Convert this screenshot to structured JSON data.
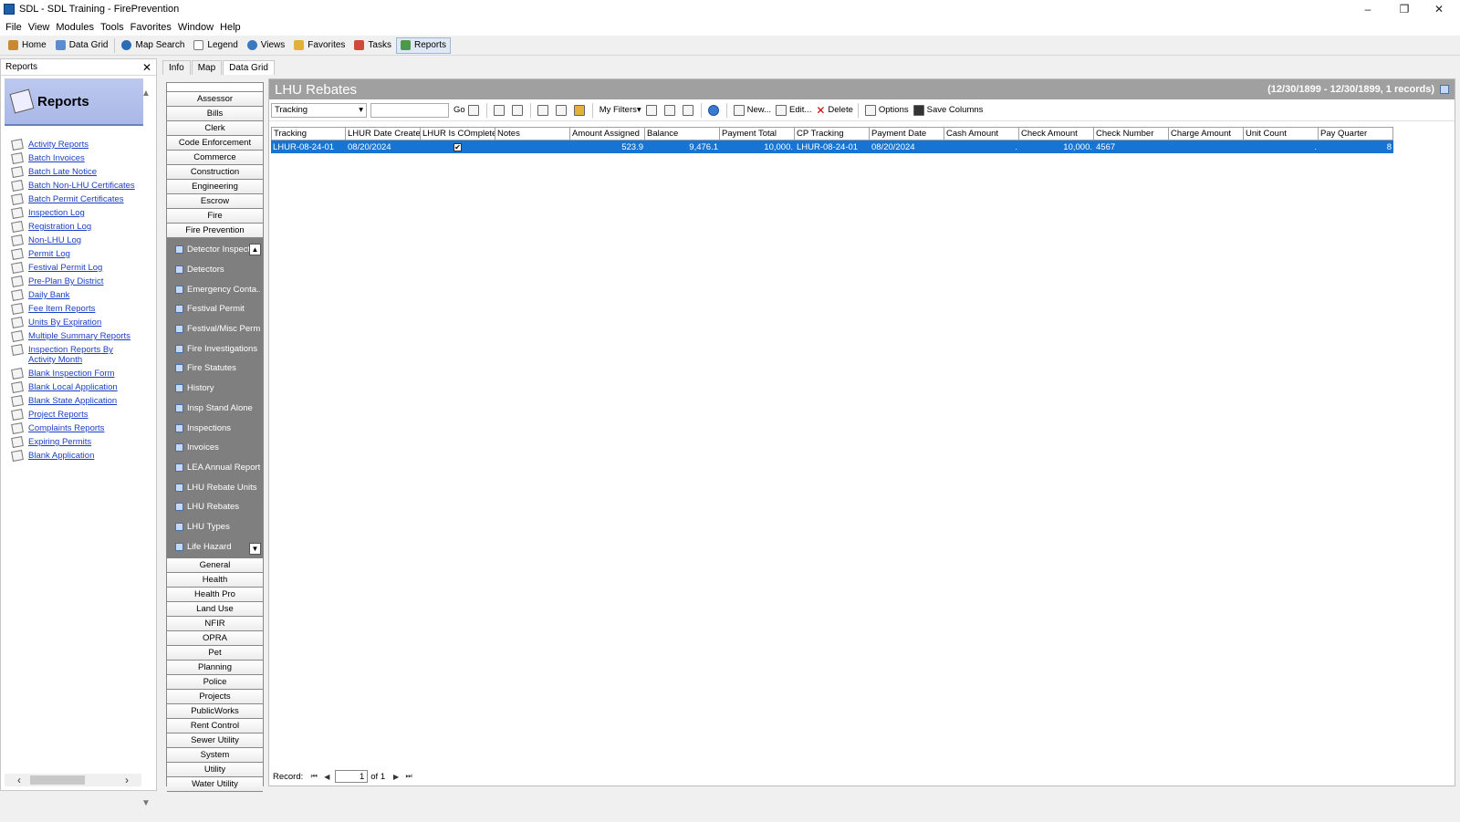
{
  "window": {
    "title": "SDL - SDL Training - FirePrevention"
  },
  "menu": [
    "File",
    "View",
    "Modules",
    "Tools",
    "Favorites",
    "Window",
    "Help"
  ],
  "toolbar": [
    {
      "label": "Home",
      "icon": "home-icon",
      "color": "#c98a2e"
    },
    {
      "label": "Data Grid",
      "icon": "grid-icon",
      "color": "#5b8bd0"
    },
    {
      "label": "Map Search",
      "icon": "globe-icon",
      "color": "#2a6db5"
    },
    {
      "label": "Legend",
      "icon": "legend-icon",
      "color": "#7a7a7a"
    },
    {
      "label": "Views",
      "icon": "views-icon",
      "color": "#3b78c2"
    },
    {
      "label": "Favorites",
      "icon": "folder-icon",
      "color": "#e3b13a"
    },
    {
      "label": "Tasks",
      "icon": "tasks-icon",
      "color": "#d04a3a"
    },
    {
      "label": "Reports",
      "icon": "reports-icon",
      "color": "#4b9a4b"
    }
  ],
  "leftpanel": {
    "header": "Reports",
    "banner": "Reports",
    "items": [
      "Activity Reports",
      "Batch Invoices",
      "Batch Late Notice",
      "Batch Non-LHU Certificates",
      "Batch Permit Certificates",
      "Inspection Log",
      "Registration Log",
      "Non-LHU Log",
      "Permit Log",
      "Festival Permit Log",
      "Pre-Plan By District",
      "Daily Bank",
      "Fee Item Reports",
      "Units By Expiration",
      "Multiple Summary Reports",
      "Inspection Reports By Activity Month",
      "Blank Inspection Form",
      "Blank Local Application",
      "Blank State Application",
      "Project Reports",
      "Complaints Reports",
      "Expiring Permits",
      "Blank Application"
    ]
  },
  "tabs": [
    "Info",
    "Map",
    "Data Grid"
  ],
  "modules_top": [
    "Assessor",
    "Bills",
    "Clerk",
    "Code Enforcement",
    "Commerce",
    "Construction",
    "Engineering",
    "Escrow",
    "Fire",
    "Fire Prevention"
  ],
  "subitems": [
    "Detector Inspect",
    "Detectors",
    "Emergency Conta...",
    "Festival Permit",
    "Festival/Misc Perm",
    "Fire Investigations",
    "Fire Statutes",
    "History",
    "Insp Stand Alone",
    "Inspections",
    "Invoices",
    "LEA Annual Report",
    "LHU Rebate Units",
    "LHU Rebates",
    "LHU Types",
    "Life Hazard"
  ],
  "modules_bottom": [
    "General",
    "Health",
    "Health Pro",
    "Land Use",
    "NFIR",
    "OPRA",
    "Pet",
    "Planning",
    "Police",
    "Projects",
    "PublicWorks",
    "Rent Control",
    "Sewer Utility",
    "System",
    "Utility",
    "Water Utility"
  ],
  "main": {
    "title": "LHU Rebates",
    "range": "(12/30/1899 - 12/30/1899, 1 records)",
    "filter_field": "Tracking",
    "go": "Go",
    "my_filters": "My Filters",
    "new_label": "New...",
    "edit_label": "Edit...",
    "delete_label": "Delete",
    "options_label": "Options",
    "save_columns_label": "Save Columns",
    "columns": [
      "Tracking",
      "LHUR Date Created",
      "LHUR Is COmplete",
      "Notes",
      "Amount Assigned",
      "Balance",
      "Payment Total",
      "CP Tracking",
      "Payment Date",
      "Cash Amount",
      "Check Amount",
      "Check Number",
      "Charge Amount",
      "Unit Count",
      "Pay Quarter"
    ],
    "rows": [
      [
        "LHUR-08-24-01",
        "08/20/2024",
        "",
        "",
        "523.9",
        "9,476.1",
        "10,000.",
        "LHUR-08-24-01",
        "08/20/2024",
        ".",
        "10,000.",
        "4567",
        "",
        ".",
        "8"
      ]
    ],
    "record_label": "Record:",
    "record_value": "1",
    "record_of": "of 1"
  }
}
